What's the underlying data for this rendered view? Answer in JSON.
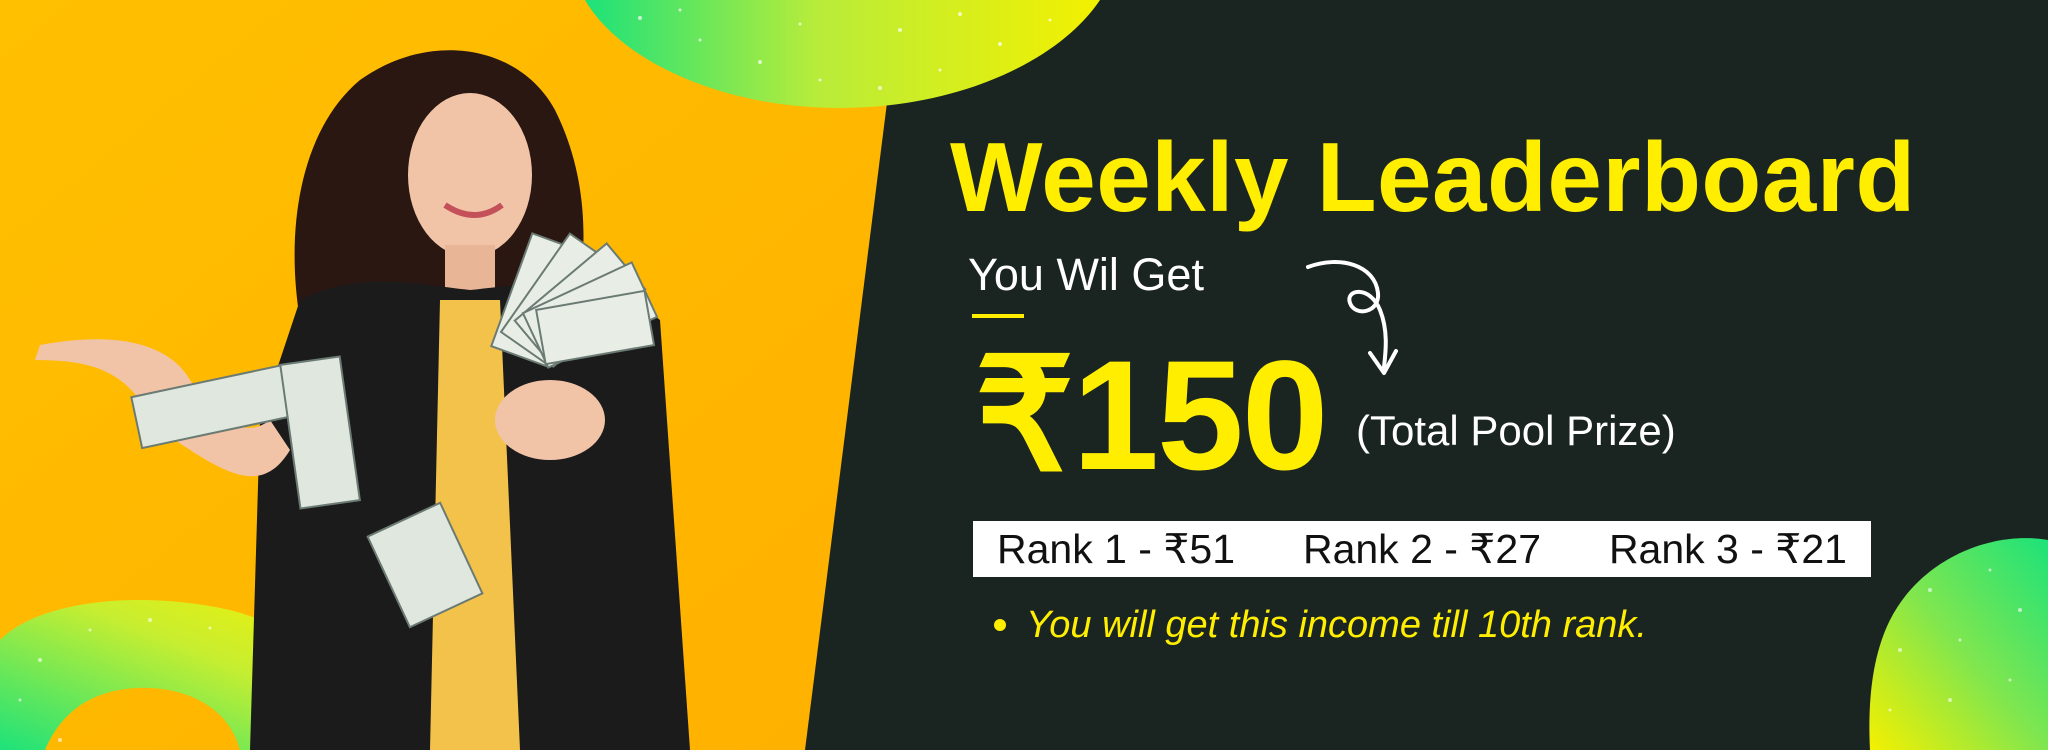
{
  "banner": {
    "title": "Weekly Leaderboard",
    "subtitle": "You Wil Get",
    "amount": "₹150",
    "amount_note": "(Total Pool Prize)",
    "ranks": [
      {
        "label": "Rank 1 - ₹51"
      },
      {
        "label": "Rank 2 - ₹27"
      },
      {
        "label": "Rank 3 - ₹21"
      }
    ],
    "bullet": "You will get this income till 10th rank."
  },
  "colors": {
    "accent_yellow": "#ffee00",
    "background_dark": "#1a2522",
    "panel_orange": "#ffc000",
    "swirl_green": "#1de27a"
  },
  "icons": {
    "arrow": "curly-arrow-icon",
    "bullet": "bullet-dot-icon"
  },
  "image": {
    "subject": "photo-woman-with-cash"
  }
}
